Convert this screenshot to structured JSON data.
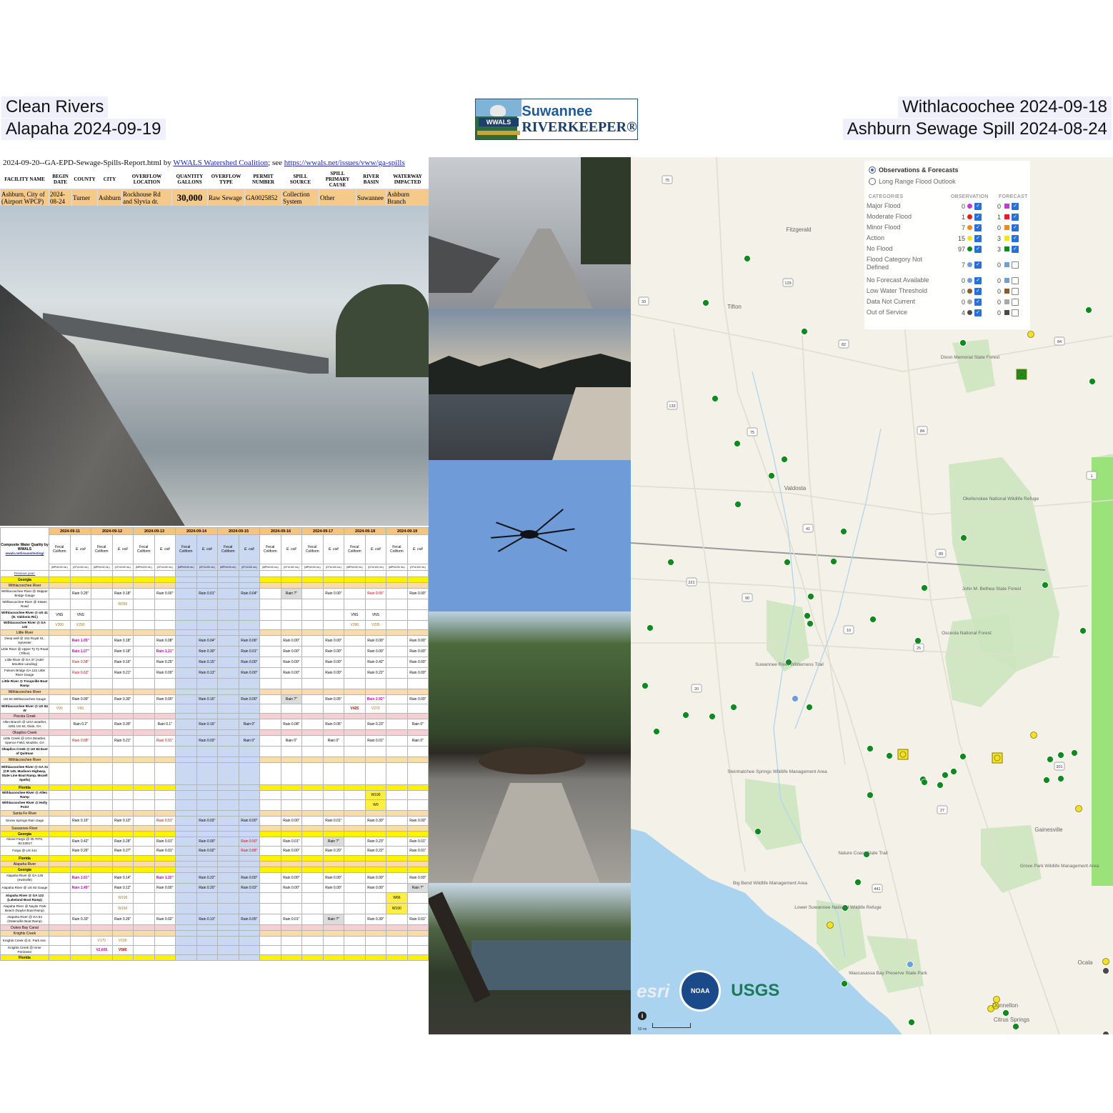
{
  "captions": {
    "top_left_1": "Clean Rivers",
    "top_left_2": "Alapaha 2024-09-19",
    "top_right_1": "Withlacoochee 2024-09-18",
    "top_right_2": "Ashburn Sewage Spill 2024-08-24"
  },
  "logo": {
    "badge_text": "WWALS",
    "line1": "Suwannee",
    "line2": "RIVERKEEPER®"
  },
  "spill_report": {
    "filename_text": "2024-09-20--GA-EPD-Sewage-Spills-Report.html by ",
    "org_link": "WWALS Watershed Coalition",
    "see_text": "; see ",
    "url": "https://wwals.net/issues/vww/ga-spills",
    "headers": [
      "FACILITY NAME",
      "BEGIN DATE",
      "COUNTY",
      "CITY",
      "OVERFLOW LOCATION",
      "QUANTITY GALLONS",
      "OVERFLOW TYPE",
      "PERMIT NUMBER",
      "SPILL SOURCE",
      "SPILL PRIMARY CAUSE",
      "RIVER BASIN",
      "WATERWAY IMPACTED"
    ],
    "row": [
      "Ashburn, City of (Airport WPCP)",
      "2024-08-24",
      "Turner",
      "Ashburn",
      "Rockhouse Rd and Slyvia dr.",
      "30,000",
      "Raw Sewage",
      "GA0025852",
      "Collection System",
      "Other",
      "Suwannee",
      "Ashburn Branch"
    ]
  },
  "water_quality": {
    "corner_title": "Composite Water Quality by WWALS",
    "corner_link": "wwals.net/issues/testing/",
    "previous_year": "Previous year:",
    "dates": [
      "2024-09-11",
      "2024-09-12",
      "2024-09-13",
      "2024-09-14",
      "2024-09-15",
      "2024-09-16",
      "2024-09-17",
      "2024-09-18",
      "2024-09-19"
    ],
    "weekend_dates": [
      "2024-09-14",
      "2024-09-15"
    ],
    "params": [
      "Fecal Coliform",
      "E. coli"
    ],
    "units": [
      "(MPN/100 mL)",
      "(CFU/100 mL)"
    ],
    "rows": [
      {
        "type": "ga",
        "name": "Georgia"
      },
      {
        "type": "basin",
        "name": "Withlacoochee River"
      },
      {
        "type": "site",
        "name": "Withlacoochee River @ Skipper Bridge Gauge",
        "cells": [
          "",
          "Rain 0.25\"",
          "",
          "Rain 0.18\"",
          "",
          "Rain 0.00\"",
          "",
          "Rain 0.01\"",
          "",
          "Rain 0.04\"",
          "",
          "Rain ?\"",
          "",
          "Rain 0.00\"",
          "",
          "Rain 0.65\"",
          "",
          "Rain 0.00\""
        ],
        "styles": {
          "11": "hg",
          "15": "red"
        }
      },
      {
        "type": "site",
        "name": "Withlacoochee River @ Staten Road",
        "cells": [
          "",
          "",
          "",
          "W266",
          "",
          "",
          "",
          "",
          "",
          "",
          "",
          "",
          "",
          "",
          "",
          "",
          "",
          ""
        ],
        "styles": {
          "3": "amb"
        }
      },
      {
        "type": "site",
        "bold": true,
        "name": "Withlacoochee River @ US 41 (N. Valdosta Rd.)",
        "cells": [
          "VNS",
          "VNS",
          "",
          "",
          "",
          "",
          "",
          "",
          "",
          "",
          "",
          "",
          "",
          "",
          "VNS",
          "VNS",
          "",
          ""
        ],
        "styles": {}
      },
      {
        "type": "site",
        "bold": true,
        "name": "Withlacoochee River @ GA 133",
        "cells": [
          "V300",
          "V290",
          "",
          "",
          "",
          "",
          "",
          "",
          "",
          "",
          "",
          "",
          "",
          "",
          "V390",
          "V295",
          "",
          ""
        ],
        "styles": {
          "0": "amb",
          "1": "amb",
          "14": "amb",
          "15": "amb"
        }
      },
      {
        "type": "basin",
        "name": "Little River"
      },
      {
        "type": "site",
        "name": "Deep well @ 161 Royal St., Sylvester",
        "cells": [
          "",
          "Rain 1.05\"",
          "",
          "Rain 0.18\"",
          "",
          "Rain 0.08\"",
          "",
          "Rain 0.04\"",
          "",
          "Rain 0.06\"",
          "",
          "Rain 0.00\"",
          "",
          "Rain 0.00\"",
          "",
          "Rain 0.00\"",
          "",
          "Rain 0.00\""
        ],
        "styles": {
          "1": "mag"
        }
      },
      {
        "type": "site",
        "name": "Little River @ Upper Ty Ty Road (Tifton)",
        "cells": [
          "",
          "Rain 1.07\"",
          "",
          "Rain 0.18\"",
          "",
          "Rain 1.21\"",
          "",
          "Rain 0.30\"",
          "",
          "Rain 0.01\"",
          "",
          "Rain 0.00\"",
          "",
          "Rain 0.00\"",
          "",
          "Rain 0.00\"",
          "",
          "Rain 0.00\""
        ],
        "styles": {
          "1": "mag",
          "5": "mag"
        }
      },
      {
        "type": "site",
        "name": "Little River @ GA 37 (Adel-Moultrie Landing)",
        "cells": [
          "",
          "Rain 0.58\"",
          "",
          "Rain 0.16\"",
          "",
          "Rain 0.25\"",
          "",
          "Rain 0.15\"",
          "",
          "Rain 0.00\"",
          "",
          "Rain 0.00\"",
          "",
          "Rain 0.00\"",
          "",
          "Rain 0.42\"",
          "",
          "Rain 0.00\""
        ],
        "styles": {
          "1": "red"
        }
      },
      {
        "type": "site",
        "name": "Folsom Bridge GA 122 Little River Gauge",
        "cells": [
          "",
          "Rain 0.63\"",
          "",
          "Rain 0.21\"",
          "",
          "Rain 0.00\"",
          "",
          "Rain 0.13\"",
          "",
          "Rain 0.00\"",
          "",
          "Rain 0.00\"",
          "",
          "Rain 0.00\"",
          "",
          "Rain 0.22\"",
          "",
          "Rain 0.00\""
        ],
        "styles": {
          "1": "red"
        }
      },
      {
        "type": "site",
        "bold": true,
        "name": "Little River @ Troupville Boat Ramp",
        "cells": [
          "",
          "",
          "",
          "",
          "",
          "",
          "",
          "",
          "",
          "",
          "",
          "",
          "",
          "",
          "",
          "",
          "",
          ""
        ],
        "styles": {}
      },
      {
        "type": "basin",
        "name": "Withlacoochee River"
      },
      {
        "type": "site",
        "name": "US 84 Withlacoochee Gauge",
        "cells": [
          "",
          "Rain 0.09\"",
          "",
          "Rain 0.30\"",
          "",
          "Rain 0.00\"",
          "",
          "Rain 0.16\"",
          "",
          "Rain 0.00\"",
          "",
          "Rain ?\"",
          "",
          "Rain 0.05\"",
          "",
          "Rain 2.92\"",
          "",
          "Rain 0.00\""
        ],
        "styles": {
          "11": "hg",
          "15": "mag"
        }
      },
      {
        "type": "site",
        "bold": true,
        "name": "Withlacoochee River @ US 84 W",
        "cells": [
          "V90",
          "V60",
          "",
          "",
          "",
          "",
          "",
          "",
          "",
          "",
          "",
          "",
          "",
          "",
          "V425",
          "V270",
          "",
          ""
        ],
        "styles": {
          "0": "amb",
          "1": "amb",
          "14": "darkred",
          "15": "amb"
        }
      },
      {
        "type": "trib",
        "name": "Piscola Creek"
      },
      {
        "type": "site",
        "name": "Allen Branch @ UGA weather, 4281 US 84, Dixie, GA",
        "cells": [
          "",
          "Rain 0.2\"",
          "",
          "Rain 0.39\"",
          "",
          "Rain 0.1\"",
          "",
          "Rain 0.16\"",
          "",
          "Rain 0\"",
          "",
          "Rain 0.08\"",
          "",
          "Rain 0.06\"",
          "",
          "Rain 0.23\"",
          "",
          "Rain 0\""
        ],
        "styles": {}
      },
      {
        "type": "trib",
        "name": "Okapilco Creek"
      },
      {
        "type": "site",
        "name": "Little Creek @ UGA Weather, Spence Field, Moultrie, GA",
        "cells": [
          "",
          "Rain 0.68\"",
          "",
          "Rain 0.21\"",
          "",
          "Rain 0.91\"",
          "",
          "Rain 0.03\"",
          "",
          "Rain 0\"",
          "",
          "Rain 0\"",
          "",
          "Rain 0\"",
          "",
          "Rain 0.01\"",
          "",
          "Rain 0\""
        ],
        "styles": {
          "1": "red",
          "5": "red"
        }
      },
      {
        "type": "site",
        "bold": true,
        "name": "Okapilco Creek @ US 84 East of Quitman",
        "cells": [
          "",
          "",
          "",
          "",
          "",
          "",
          "",
          "",
          "",
          "",
          "",
          "",
          "",
          "",
          "",
          "",
          "",
          ""
        ],
        "styles": {}
      },
      {
        "type": "basin",
        "name": "Withlacoochee River"
      },
      {
        "type": "site",
        "bold": true,
        "name": "Withlacoochee River @ GA 31 (CR 145, Madison Highway, State Line Boat Ramp, Mozell Spells)",
        "cells": [
          "",
          "",
          "",
          "",
          "",
          "",
          "",
          "",
          "",
          "",
          "",
          "",
          "",
          "",
          "",
          "",
          "",
          ""
        ],
        "styles": {}
      },
      {
        "type": "ga",
        "name": "Florida"
      },
      {
        "type": "site",
        "bold": true,
        "name": "Withlacoochee River @ Allen Ramp",
        "cells": [
          "",
          "",
          "",
          "",
          "",
          "",
          "",
          "",
          "",
          "",
          "",
          "",
          "",
          "",
          "",
          "W100",
          "",
          ""
        ],
        "styles": {
          "15": "hy"
        }
      },
      {
        "type": "site",
        "bold": true,
        "name": "Withlacoochee River @ Holly Point",
        "cells": [
          "",
          "",
          "",
          "",
          "",
          "",
          "",
          "",
          "",
          "",
          "",
          "",
          "",
          "",
          "",
          "W0",
          "",
          ""
        ],
        "styles": {
          "15": "hy"
        }
      },
      {
        "type": "basin",
        "name": "Santa Fe River"
      },
      {
        "type": "site",
        "name": "Ginnie Springs Rain Gage",
        "cells": [
          "",
          "Rain 0.16\"",
          "",
          "Rain 0.10\"",
          "",
          "Rain 0.51\"",
          "",
          "Rain 0.03\"",
          "",
          "Rain 0.00\"",
          "",
          "Rain 0.00\"",
          "",
          "Rain 0.01\"",
          "",
          "Rain 0.30\"",
          "",
          "Rain 0.00\""
        ],
        "styles": {
          "5": "red"
        }
      },
      {
        "type": "basin",
        "name": "Suwannee River"
      },
      {
        "type": "ga",
        "name": "Georgia"
      },
      {
        "type": "site",
        "name": "Above Fargo @ 30.7075, -82.53917",
        "cells": [
          "",
          "Rain 0.42\"",
          "",
          "Rain 0.28\"",
          "",
          "Rain 0.01\"",
          "",
          "Rain 0.00\"",
          "",
          "Rain 0.50\"",
          "",
          "Rain 0.01\"",
          "",
          "Rain ?\"",
          "",
          "Rain 0.23\"",
          "",
          "Rain 0.01\""
        ],
        "styles": {
          "9": "red",
          "13": "hg"
        }
      },
      {
        "type": "site",
        "name": "Fargo @ US 441",
        "cells": [
          "",
          "Rain 0.26\"",
          "",
          "Rain 0.27\"",
          "",
          "Rain 0.01\"",
          "",
          "Rain 0.02\"",
          "",
          "Rain 0.88\"",
          "",
          "Rain 0.00\"",
          "",
          "Rain 0.20\"",
          "",
          "Rain 0.22\"",
          "",
          "Rain 0.01\""
        ],
        "styles": {
          "9": "red"
        }
      },
      {
        "type": "ga",
        "name": "Florida"
      },
      {
        "type": "basin",
        "name": "Alapaha River"
      },
      {
        "type": "ga",
        "name": "Georgia"
      },
      {
        "type": "site",
        "name": "Alapaha River @ GA 125 (Irwinville)",
        "cells": [
          "",
          "Rain 1.61\"",
          "",
          "Rain 0.14\"",
          "",
          "Rain 1.22\"",
          "",
          "Rain 0.22\"",
          "",
          "Rain 0.00\"",
          "",
          "Rain 0.00\"",
          "",
          "Rain 0.00\"",
          "",
          "Rain 0.00\"",
          "",
          "Rain 0.00\""
        ],
        "styles": {
          "1": "mag",
          "5": "mag"
        }
      },
      {
        "type": "site",
        "name": "Alapaha River @ US 82 Gauge",
        "cells": [
          "",
          "Rain 1.49\"",
          "",
          "Rain 0.12\"",
          "",
          "Rain 0.00\"",
          "",
          "Rain 0.20\"",
          "",
          "Rain 0.02\"",
          "",
          "Rain 0.00\"",
          "",
          "Rain 0.00\"",
          "",
          "Rain 0.00\"",
          "",
          "Rain ?\""
        ],
        "styles": {
          "1": "mag",
          "17": "hg"
        }
      },
      {
        "type": "site",
        "bold": true,
        "name": "Alapaha River @ GA 122 (Lakeland Boat Ramp)",
        "cells": [
          "",
          "",
          "",
          "W100",
          "",
          "",
          "",
          "",
          "",
          "",
          "",
          "",
          "",
          "",
          "",
          "",
          "W66",
          ""
        ],
        "styles": {
          "3": "amb",
          "16": "hy"
        }
      },
      {
        "type": "site",
        "name": "Alapaha River @ Naylor Park Beach (Naylor Boat Ramp)",
        "cells": [
          "",
          "",
          "",
          "W156",
          "",
          "",
          "",
          "",
          "",
          "",
          "",
          "",
          "",
          "",
          "",
          "",
          "W100",
          ""
        ],
        "styles": {
          "3": "amb",
          "16": "hy"
        }
      },
      {
        "type": "site",
        "name": "Alapaha River @ GA 94 (Statenville Boat Ramp)",
        "cells": [
          "",
          "Rain 0.33\"",
          "",
          "Rain 0.26\"",
          "",
          "Rain 0.02\"",
          "",
          "Rain 0.13\"",
          "",
          "Rain 0.05\"",
          "",
          "Rain 0.01\"",
          "",
          "Rain ?\"",
          "",
          "Rain 0.39\"",
          "",
          "Rain 0.01\""
        ],
        "styles": {
          "13": "hg"
        }
      },
      {
        "type": "trib",
        "name": "Dukes Bay Canal"
      },
      {
        "type": "basin",
        "name": "Knights Creek"
      },
      {
        "type": "site",
        "name": "Knights Creek @ E. Park Ave.",
        "cells": [
          "",
          "",
          "V170",
          "V100",
          "",
          "",
          "",
          "",
          "",
          "",
          "",
          "",
          "",
          "",
          "",
          "",
          "",
          ""
        ],
        "styles": {
          "2": "amb",
          "3": "amb"
        }
      },
      {
        "type": "site",
        "name": "Knights Creek @ Inner Perimeter",
        "cells": [
          "",
          "",
          "V2,605",
          "V580",
          "",
          "",
          "",
          "",
          "",
          "",
          "",
          "",
          "",
          "",
          "",
          "",
          "",
          ""
        ],
        "styles": {
          "2": "mag",
          "3": "darkred"
        }
      },
      {
        "type": "ga",
        "name": "Florida"
      }
    ]
  },
  "flood_map": {
    "mode_options": [
      "Observations & Forecasts",
      "Long Range Flood Outlook"
    ],
    "selected_mode": "Observations & Forecasts",
    "headers": {
      "categories": "CATEGORIES",
      "observation": "OBSERVATION",
      "forecast": "FORECAST"
    },
    "categories": [
      {
        "label": "Major Flood",
        "obs": "0",
        "fc": "0",
        "color": "#c33ad6",
        "checked": true
      },
      {
        "label": "Moderate Flood",
        "obs": "1",
        "fc": "1",
        "color": "#e0201c",
        "checked": true
      },
      {
        "label": "Minor Flood",
        "obs": "7",
        "fc": "0",
        "color": "#f08a1c",
        "checked": true
      },
      {
        "label": "Action",
        "obs": "15",
        "fc": "3",
        "color": "#f2e227",
        "checked": true
      },
      {
        "label": "No Flood",
        "obs": "97",
        "fc": "3",
        "color": "#0f8a1e",
        "checked": true
      },
      {
        "label": "Flood Category Not Defined",
        "obs": "7",
        "fc": "0",
        "color": "#6e9fd6",
        "checked": true
      },
      {
        "label": "No Forecast Available",
        "obs": "0",
        "fc": "0",
        "color": "#6e9fd6",
        "checked": true
      },
      {
        "label": "Low Water Threshold",
        "obs": "0",
        "fc": "0",
        "color": "#8a5a2a",
        "checked": true
      },
      {
        "label": "Data Not Current",
        "obs": "0",
        "fc": "0",
        "color": "#a8a8a8",
        "checked": true
      },
      {
        "label": "Out of Service",
        "obs": "4",
        "fc": "0",
        "color": "#4a4a4a",
        "checked": true
      }
    ],
    "places": [
      "Fitzgerald",
      "Tifton",
      "Valdosta",
      "Dixon Memorial State Forest",
      "Okefenokee National Wildlife Refuge",
      "John M. Bethea State Forest",
      "Osceola National Forest",
      "Suwannee River Wilderness Trail",
      "Steinhatchee Springs Wildlife Management Area",
      "Nature Coast State Trail",
      "Lower Suwannee National Wildlife Refuge",
      "Big Bend Wildlife Management Area",
      "Gainesville",
      "Grove Park Wildlife Management Area",
      "Waccasassa Bay Preserve State Park",
      "Ocala",
      "Dunnellon",
      "Citrus Springs"
    ],
    "highways": [
      "75",
      "129",
      "33",
      "82",
      "84",
      "133",
      "75",
      "84",
      "1",
      "41",
      "221",
      "90",
      "89",
      "10",
      "25",
      "20",
      "27",
      "301",
      "441"
    ],
    "attribution": {
      "esri": "esri",
      "noaa": "NOAA",
      "usgs": "USGS"
    },
    "scale_label": "50 mi"
  }
}
